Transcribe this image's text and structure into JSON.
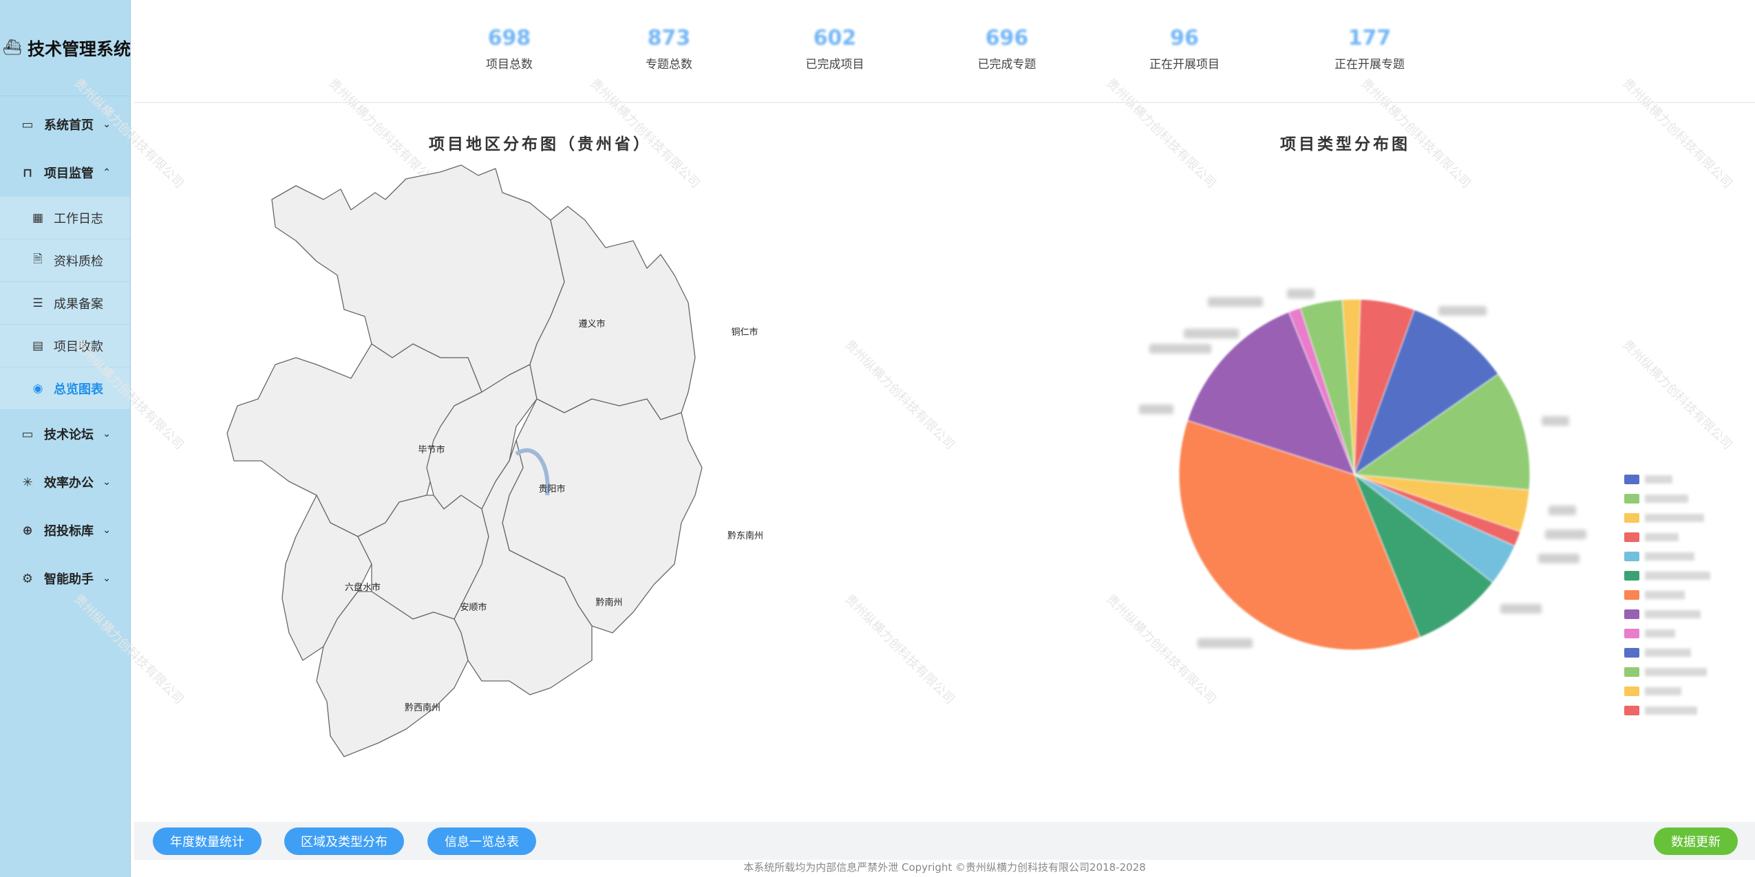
{
  "brand": {
    "title": "技术管理系统",
    "logo_icon": "ship-icon"
  },
  "sidebar": {
    "items": [
      {
        "label": "系统首页",
        "icon": "monitor-icon"
      },
      {
        "label": "项目监管",
        "icon": "presentation-icon",
        "expanded": true,
        "children": [
          {
            "label": "工作日志",
            "icon": "calendar-icon"
          },
          {
            "label": "资料质检",
            "icon": "file-check-icon"
          },
          {
            "label": "成果备案",
            "icon": "stack-icon"
          },
          {
            "label": "项目收款",
            "icon": "credit-card-icon"
          },
          {
            "label": "总览图表",
            "icon": "eye-icon",
            "active": true
          }
        ]
      },
      {
        "label": "技术论坛",
        "icon": "chat-icon"
      },
      {
        "label": "效率办公",
        "icon": "sparkle-icon"
      },
      {
        "label": "招投标库",
        "icon": "target-icon"
      },
      {
        "label": "智能助手",
        "icon": "chip-icon"
      }
    ]
  },
  "stats": [
    {
      "value": "698",
      "label": "项目总数"
    },
    {
      "value": "873",
      "label": "专题总数"
    },
    {
      "value": "602",
      "label": "已完成项目"
    },
    {
      "value": "696",
      "label": "已完成专题"
    },
    {
      "value": "96",
      "label": "正在开展项目"
    },
    {
      "value": "177",
      "label": "正在开展专题"
    }
  ],
  "map": {
    "title": "项目地区分布图（贵州省）",
    "regions": [
      "遵义市",
      "铜仁市",
      "毕节市",
      "贵阳市",
      "黔东南州",
      "六盘水市",
      "安顺市",
      "黔南州",
      "黔西南州"
    ]
  },
  "pie": {
    "title": "项目类型分布图",
    "colors": [
      "#5470c6",
      "#91cc75",
      "#fac858",
      "#ee6666",
      "#73c0de",
      "#3ba272",
      "#fc8452",
      "#9a60b4",
      "#ea7ccc",
      "#5470c6",
      "#91cc75",
      "#fac858",
      "#ee6666"
    ]
  },
  "watermark": "贵州纵横力创科技有限公司",
  "buttons": {
    "annual": "年度数量统计",
    "region": "区域及类型分布",
    "info": "信息一览总表",
    "refresh": "数据更新"
  },
  "footer": "本系统所载均为内部信息严禁外泄 Copyright ©贵州纵横力创科技有限公司2018-2028"
}
